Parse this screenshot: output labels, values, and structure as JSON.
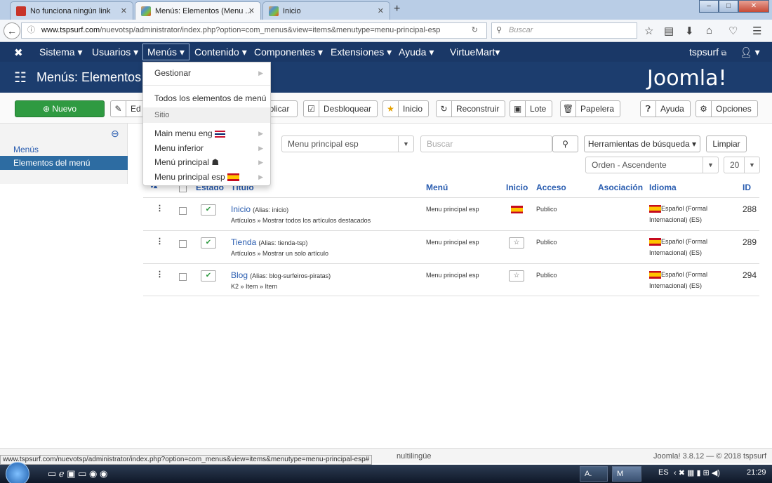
{
  "browser": {
    "tabs": [
      {
        "title": "No funciona ningún link",
        "active": false
      },
      {
        "title": "Menús: Elementos (Menu ...",
        "active": true
      },
      {
        "title": "Inicio",
        "active": false
      }
    ],
    "url_domain": "www.tspsurf.com",
    "url_path": "/nuevotsp/administrator/index.php?option=com_menus&view=items&menutype=menu-principal-esp",
    "search_placeholder": "Buscar"
  },
  "adminnav": {
    "items": [
      "Sistema ▾",
      "Usuarios ▾",
      "Menús ▾",
      "Contenido ▾",
      "Componentes ▾",
      "Extensiones ▾",
      "Ayuda ▾",
      "VirtueMart▾"
    ],
    "user": "tspsurf",
    "user_menu": "▾"
  },
  "header": {
    "title": "Menús: Elementos (",
    "logo": "Joomla!"
  },
  "toolbar": {
    "new": "Nuevo",
    "edit": "Ed",
    "publish": "ublicar",
    "unlock": "Desbloquear",
    "home": "Inicio",
    "rebuild": "Reconstruir",
    "batch": "Lote",
    "trash": "Papelera",
    "help": "Ayuda",
    "options": "Opciones"
  },
  "sidebar": {
    "menus": "Menús",
    "items": "Elementos del menú"
  },
  "dropdown": {
    "manage": "Gestionar",
    "all_items": "Todos los elementos de menú",
    "site": "Sitio",
    "menus": [
      "Main menu eng",
      "Menu inferior",
      "Menú principal",
      "Menu principal esp"
    ]
  },
  "filters": {
    "menu_select": "Menu principal esp",
    "search_placeholder": "Buscar",
    "search_tools": "Herramientas de búsqueda",
    "clear": "Limpiar",
    "order": "Orden - Ascendente",
    "limit": "20"
  },
  "table": {
    "headers": {
      "estado": "Estado",
      "titulo": "Título",
      "menu": "Menú",
      "inicio": "Inicio",
      "acceso": "Acceso",
      "asociacion": "Asociación",
      "idioma": "Idioma",
      "id": "ID"
    },
    "rows": [
      {
        "title": "Inicio",
        "alias": "(Alias: inicio)",
        "type": "Artículos » Mostrar todos los artículos destacados",
        "menu": "Menu principal esp",
        "access": "Publico",
        "lang1": "Español (Formal",
        "lang2": "Internacional) (ES)",
        "id": "288",
        "home": true
      },
      {
        "title": "Tienda",
        "alias": "(Alias: tienda-tsp)",
        "type": "Artículos » Mostrar un solo artículo",
        "menu": "Menu principal esp",
        "access": "Publico",
        "lang1": "Español (Formal",
        "lang2": "Internacional) (ES)",
        "id": "289",
        "home": false
      },
      {
        "title": "Blog",
        "alias": "(Alias: blog-surfeiros-piratas)",
        "type": "K2 » Item » Item",
        "menu": "Menu principal esp",
        "access": "Publico",
        "lang1": "Español (Formal",
        "lang2": "Internacional) (ES)",
        "id": "294",
        "home": false
      }
    ]
  },
  "footer": {
    "status_url": "www.tspsurf.com/nuevotsp/administrator/index.php?option=com_menus&view=items&menutype=menu-principal-esp#",
    "multilingual": "nultilingüe",
    "version": "Joomla! 3.8.12 — © 2018 tspsurf"
  },
  "taskbar": {
    "lang": "ES",
    "time": "21:29",
    "app1": "A.",
    "app2": "M"
  }
}
